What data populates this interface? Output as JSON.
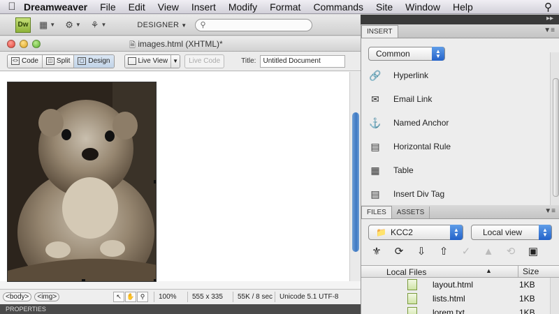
{
  "menubar": {
    "app_name": "Dreamweaver",
    "items": [
      "File",
      "Edit",
      "View",
      "Insert",
      "Modify",
      "Format",
      "Commands",
      "Site",
      "Window",
      "Help"
    ]
  },
  "toolbar": {
    "logo_text": "Dw",
    "workspace_label": "DESIGNER"
  },
  "document": {
    "tab_name": "images.html (XHTML)*",
    "view_buttons": [
      "Code",
      "Split",
      "Design"
    ],
    "active_view": "Design",
    "live_view_label": "Live View",
    "live_code_label": "Live Code",
    "title_label": "Title:",
    "title_value": "Untitled Document"
  },
  "statusbar": {
    "tags": [
      "<body>",
      "<img>"
    ],
    "zoom": "100%",
    "dimensions": "555 x 335",
    "download": "55K / 8 sec",
    "encoding": "Unicode 5.1 UTF-8"
  },
  "properties_label": "PROPERTIES",
  "insert_panel": {
    "tab": "INSERT",
    "category": "Common",
    "items": [
      {
        "label": "Hyperlink",
        "icon": "hyperlink-icon"
      },
      {
        "label": "Email Link",
        "icon": "email-link-icon"
      },
      {
        "label": "Named Anchor",
        "icon": "named-anchor-icon"
      },
      {
        "label": "Horizontal Rule",
        "icon": "horizontal-rule-icon"
      },
      {
        "label": "Table",
        "icon": "table-icon"
      },
      {
        "label": "Insert Div Tag",
        "icon": "div-tag-icon"
      }
    ]
  },
  "files_panel": {
    "tabs": [
      "FILES",
      "ASSETS"
    ],
    "site": "KCC2",
    "view": "Local view",
    "columns": [
      "Local Files",
      "Size"
    ],
    "rows": [
      {
        "name": "layout.html",
        "size": "1KB"
      },
      {
        "name": "lists.html",
        "size": "1KB"
      },
      {
        "name": "lorem.txt",
        "size": "1KB"
      }
    ]
  }
}
